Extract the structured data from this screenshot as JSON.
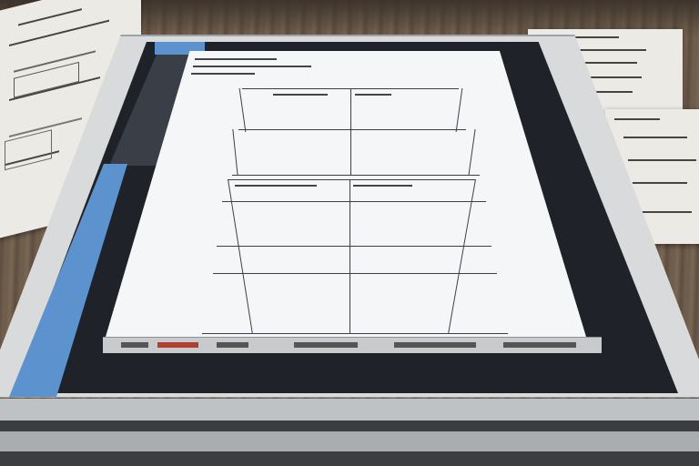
{
  "scene": {
    "description_free": true,
    "colors": {
      "desk": "#6b5a4a",
      "bezel": "#d9dadb",
      "screen": "#1f2329",
      "accent_blue": "#5c93cf",
      "page": "#f5f6f7"
    },
    "objects": [
      {
        "name": "tablet-device"
      },
      {
        "name": "left-blueprint-sheet"
      },
      {
        "name": "right-notes-sheet"
      },
      {
        "name": "document-page-with-table-grid"
      }
    ]
  }
}
